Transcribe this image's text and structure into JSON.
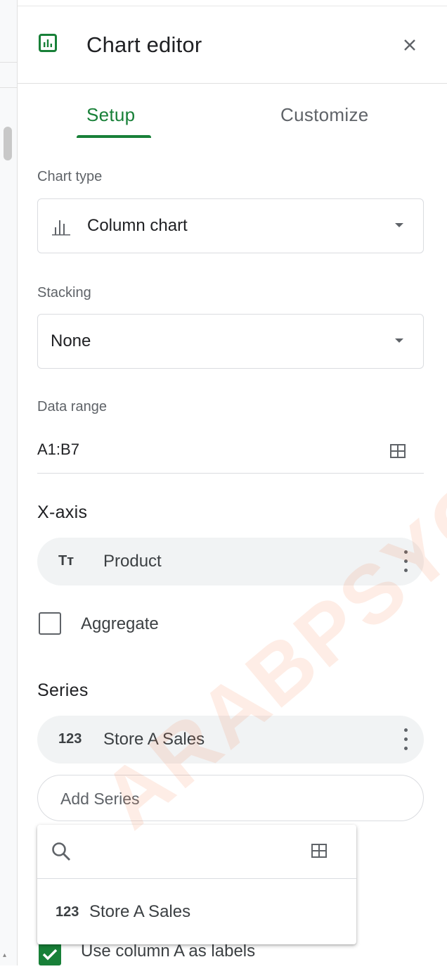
{
  "header": {
    "title": "Chart editor",
    "logo_icon": "chart-logo-icon",
    "close_icon": "close-icon"
  },
  "tabs": [
    {
      "label": "Setup",
      "active": true
    },
    {
      "label": "Customize",
      "active": false
    }
  ],
  "chart_type": {
    "label": "Chart type",
    "value": "Column chart",
    "icon": "column-chart-icon"
  },
  "stacking": {
    "label": "Stacking",
    "value": "None"
  },
  "data_range": {
    "label": "Data range",
    "value": "A1:B7",
    "icon": "grid-select-icon"
  },
  "x_axis": {
    "title": "X-axis",
    "chip": {
      "type_icon": "Tт",
      "label": "Product"
    },
    "aggregate": {
      "label": "Aggregate",
      "checked": false
    }
  },
  "series": {
    "title": "Series",
    "chip": {
      "type_icon": "123",
      "label": "Store A Sales"
    },
    "add_label": "Add Series"
  },
  "series_dropdown": {
    "search_placeholder": "",
    "option": {
      "type_icon": "123",
      "label": "Store A Sales"
    }
  },
  "labels_checkbox": {
    "label": "Use column A as labels",
    "checked": true
  },
  "watermark": "ARABPSYCH",
  "colors": {
    "accent": "#188038",
    "text": "#202124",
    "muted": "#5f6368",
    "chip_bg": "#f1f3f4",
    "border": "#dadce0"
  }
}
